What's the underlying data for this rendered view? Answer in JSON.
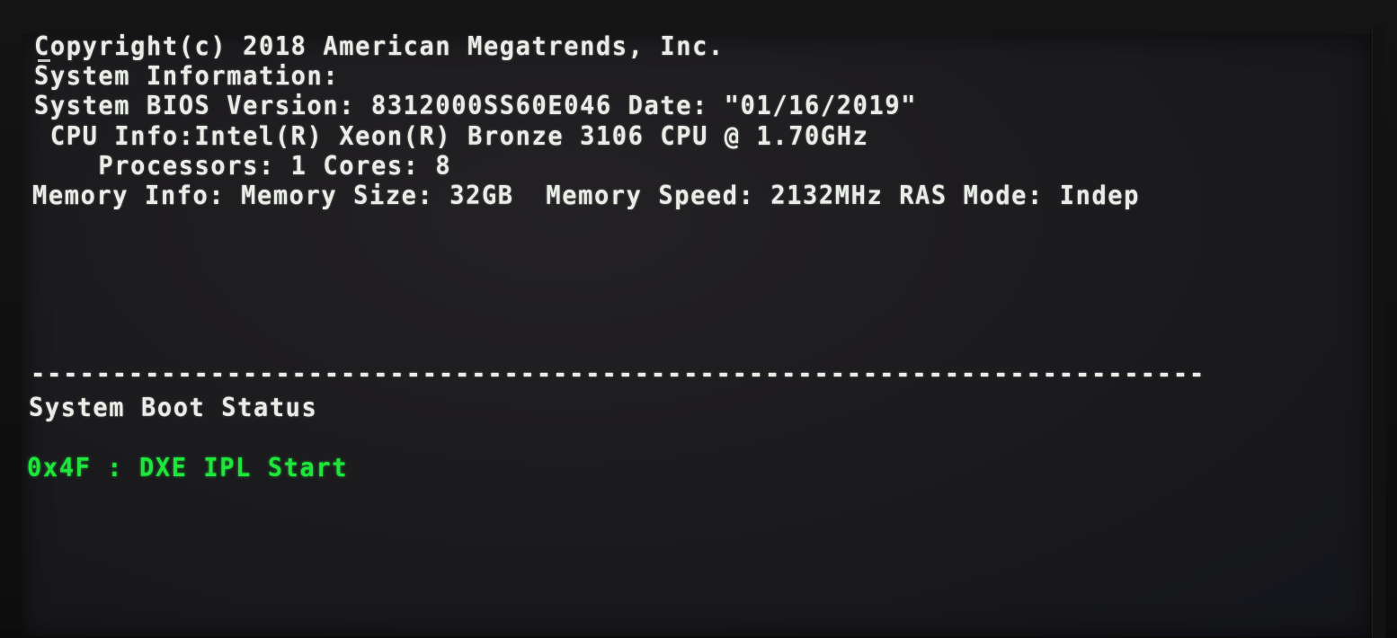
{
  "post_screen": {
    "copyright": "Copyright(c) 2018 American Megatrends, Inc.",
    "system_info_heading": "System Information:",
    "bios_version_line": "System BIOS Version: 8312000SS60E046 Date: \"01/16/2019\"",
    "cpu_info_line": " CPU Info:Intel(R) Xeon(R) Bronze 3106 CPU @ 1.70GHz",
    "processors_line": "    Processors: 1 Cores: 8",
    "memory_info_line": "Memory Info: Memory Size: 32GB  Memory Speed: 2132MHz RAS Mode: Indep",
    "separator": "------------------------------------------------------------------------",
    "boot_status_heading": "System Boot Status",
    "boot_status_code": "0x4F : DXE IPL Start"
  },
  "colors": {
    "text": "#e9ece6",
    "status_green": "#1fe63a",
    "background": "#1c1b1e"
  }
}
